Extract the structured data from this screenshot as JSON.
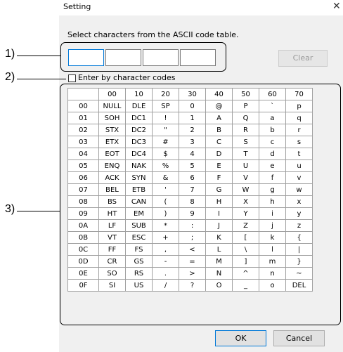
{
  "dialog": {
    "title": "Setting",
    "close_glyph": "✕",
    "instruction": "Select characters from the ASCII code table.",
    "clear_label": "Clear",
    "checkbox_label": "Enter by character codes",
    "checkbox_checked": false,
    "ok_label": "OK",
    "cancel_label": "Cancel"
  },
  "annotations": {
    "one": "1)",
    "two": "2)",
    "three": "3)"
  },
  "table": {
    "columns": [
      "",
      "00",
      "10",
      "20",
      "30",
      "40",
      "50",
      "60",
      "70"
    ],
    "rows": [
      [
        "00",
        "NULL",
        "DLE",
        "SP",
        "0",
        "@",
        "P",
        "`",
        "p"
      ],
      [
        "01",
        "SOH",
        "DC1",
        "!",
        "1",
        "A",
        "Q",
        "a",
        "q"
      ],
      [
        "02",
        "STX",
        "DC2",
        "\"",
        "2",
        "B",
        "R",
        "b",
        "r"
      ],
      [
        "03",
        "ETX",
        "DC3",
        "#",
        "3",
        "C",
        "S",
        "c",
        "s"
      ],
      [
        "04",
        "EOT",
        "DC4",
        "$",
        "4",
        "D",
        "T",
        "d",
        "t"
      ],
      [
        "05",
        "ENQ",
        "NAK",
        "%",
        "5",
        "E",
        "U",
        "e",
        "u"
      ],
      [
        "06",
        "ACK",
        "SYN",
        "&",
        "6",
        "F",
        "V",
        "f",
        "v"
      ],
      [
        "07",
        "BEL",
        "ETB",
        "'",
        "7",
        "G",
        "W",
        "g",
        "w"
      ],
      [
        "08",
        "BS",
        "CAN",
        "(",
        "8",
        "H",
        "X",
        "h",
        "x"
      ],
      [
        "09",
        "HT",
        "EM",
        ")",
        "9",
        "I",
        "Y",
        "i",
        "y"
      ],
      [
        "0A",
        "LF",
        "SUB",
        "*",
        ":",
        "J",
        "Z",
        "j",
        "z"
      ],
      [
        "0B",
        "VT",
        "ESC",
        "+",
        ";",
        "K",
        "[",
        "k",
        "{"
      ],
      [
        "0C",
        "FF",
        "FS",
        ",",
        "<",
        "L",
        "\\",
        "l",
        "|"
      ],
      [
        "0D",
        "CR",
        "GS",
        "-",
        "=",
        "M",
        "]",
        "m",
        "}"
      ],
      [
        "0E",
        "SO",
        "RS",
        ".",
        ">",
        "N",
        "^",
        "n",
        "~"
      ],
      [
        "0F",
        "SI",
        "US",
        "/",
        "?",
        "O",
        "_",
        "o",
        "DEL"
      ]
    ]
  }
}
